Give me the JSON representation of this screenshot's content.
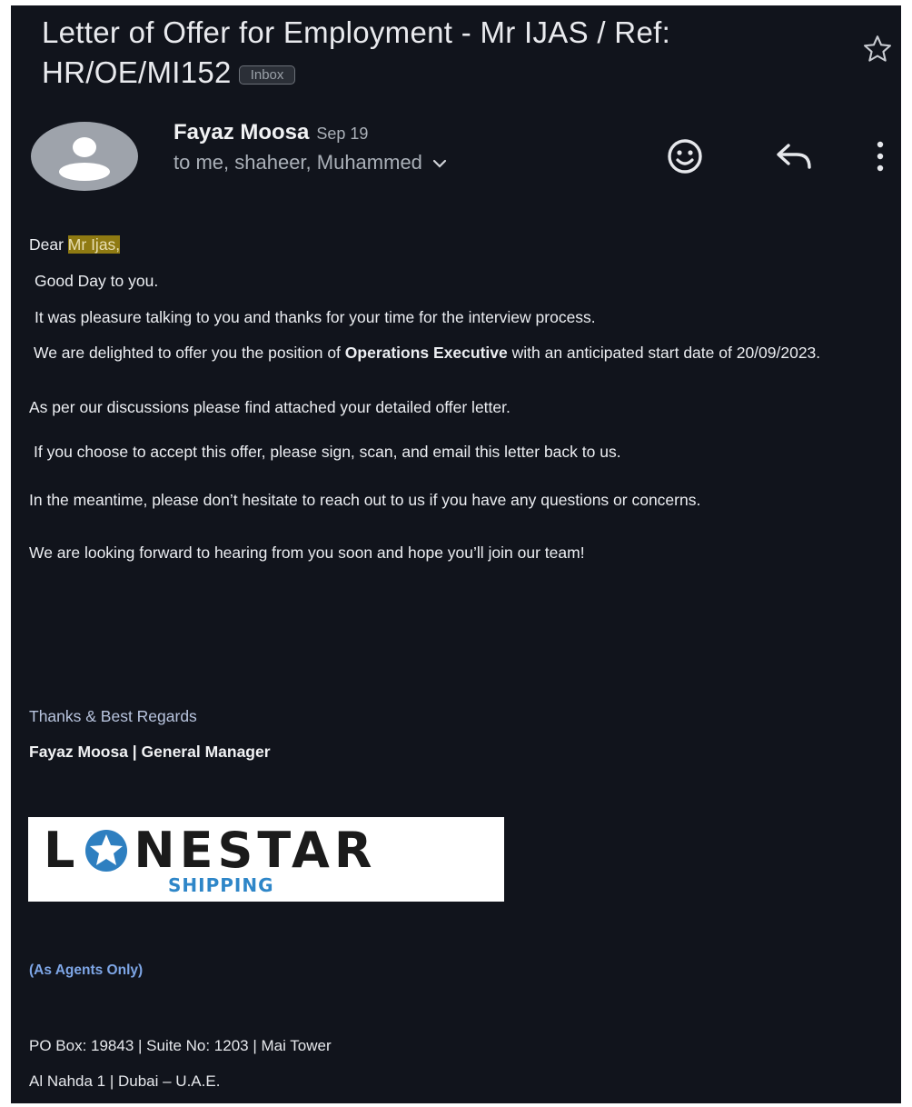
{
  "email": {
    "subject": "Letter of Offer for Employment - Mr IJAS / Ref: HR/OE/MI152",
    "label": "Inbox",
    "sender_name": "Fayaz Moosa",
    "date": "Sep 19",
    "recipients": "to me, shaheer, Muhammed"
  },
  "body": {
    "greeting_prefix": "Dear ",
    "greeting_name": "Mr Ijas,",
    "p1": "Good Day to you.",
    "p2": "It was pleasure talking to you and thanks for your time for the interview process.",
    "p3_pre": "We are delighted to offer you the position of ",
    "p3_bold": "Operations Executive",
    "p3_post": " with an anticipated start date of 20/09/2023.",
    "p4": "As per our discussions please find attached your detailed offer letter.",
    "p5": "If you choose to accept this offer, please sign, scan, and email this letter back to us.",
    "p6": "In the meantime, please don’t hesitate to reach out to us if you have any questions or concerns.",
    "p7": "We are looking forward to hearing from you soon and hope you’ll join our team!"
  },
  "signature": {
    "closing": "Thanks & Best Regards",
    "name_title": "Fayaz Moosa | General Manager",
    "logo_left": "L",
    "logo_right": "NESTAR",
    "logo_sub": "SHIPPING",
    "agents": "(As Agents Only)",
    "address1": "PO Box: 19843 | Suite No: 1203 | Mai Tower",
    "address2": "Al Nahda 1 | Dubai – U.A.E."
  },
  "icons": {
    "star": "star-outline-icon",
    "avatar": "person-avatar-icon",
    "expand": "chevron-down-icon",
    "react": "emoji-smile-icon",
    "reply": "reply-arrow-icon",
    "more": "more-vertical-icon",
    "logo_star": "lonestar-star-logo"
  },
  "colors": {
    "background": "#11141c",
    "highlight": "#8f7a12",
    "agents_link": "#7ea6e6",
    "logo_blue": "#2e86c8"
  }
}
